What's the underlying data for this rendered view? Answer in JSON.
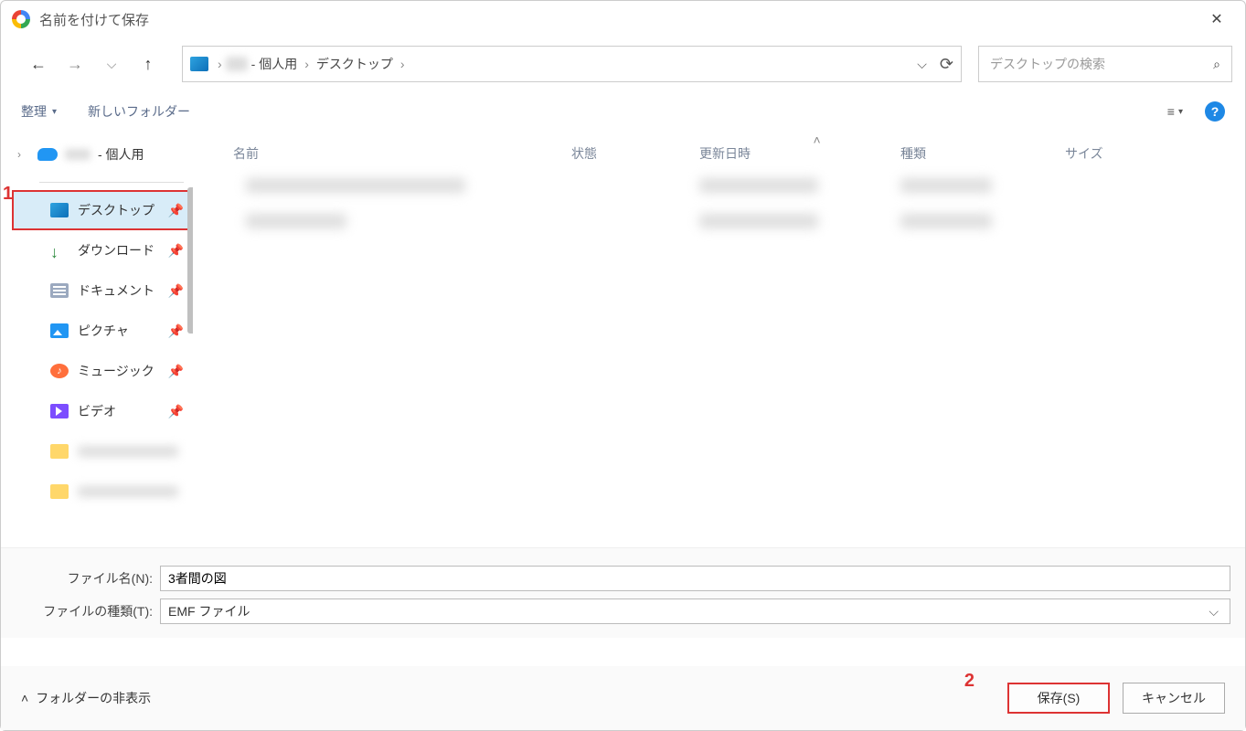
{
  "title": "名前を付けて保存",
  "breadcrumb": {
    "segment_personal_suffix": " - 個人用",
    "segment_desktop": "デスクトップ"
  },
  "search": {
    "placeholder": "デスクトップの検索"
  },
  "toolbar": {
    "organize": "整理",
    "new_folder": "新しいフォルダー"
  },
  "tree": {
    "onedrive_suffix": " - 個人用"
  },
  "sidebar": {
    "desktop": "デスクトップ",
    "downloads": "ダウンロード",
    "documents": "ドキュメント",
    "pictures": "ピクチャ",
    "music": "ミュージック",
    "videos": "ビデオ"
  },
  "columns": {
    "name": "名前",
    "state": "状態",
    "date": "更新日時",
    "type": "種類",
    "size": "サイズ"
  },
  "fields": {
    "filename_label": "ファイル名(N):",
    "filename_value": "3者間の図",
    "filetype_label": "ファイルの種類(T):",
    "filetype_value": "EMF ファイル"
  },
  "footer": {
    "hide_folders": "フォルダーの非表示",
    "save": "保存(S)",
    "cancel": "キャンセル"
  },
  "callouts": {
    "one": "1",
    "two": "2"
  }
}
